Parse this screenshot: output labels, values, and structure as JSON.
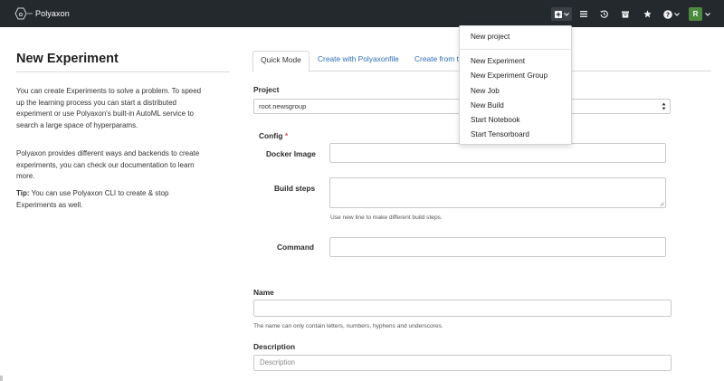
{
  "navbar": {
    "brand": "Polyaxon",
    "avatar_initial": "R",
    "background": "#24292e"
  },
  "sidebar": {
    "title": "New Experiment",
    "paragraph1": "You can create Experiments to solve a problem. To speed up the learning process you can start a distributed experiment or use Polyaxon's built-in AutoML service to search a large space of hyperparams.",
    "paragraph2": "Polyaxon provides different ways and backends to create experiments, you can check our documentation to learn more.",
    "tip_label": "Tip:",
    "tip_text": " You can use Polyaxon CLI to create & stop Experiments as well."
  },
  "tabs": [
    {
      "label": "Quick Mode",
      "active": true
    },
    {
      "label": "Create with Polyaxonfile",
      "active": false
    },
    {
      "label": "Create from t",
      "active": false
    }
  ],
  "form": {
    "project_label": "Project",
    "project_value": "root.newsgroup",
    "config_label": "Config",
    "required_mark": "*",
    "docker_image_label": "Docker Image",
    "build_steps_label": "Build steps",
    "build_steps_help": "Use new line to make different build steps.",
    "command_label": "Command",
    "name_label": "Name",
    "name_help": "The name can only contain letters, numbers, hyphens and underscores.",
    "description_label": "Description",
    "description_placeholder": "Description"
  },
  "dropdown": {
    "items": [
      "New project",
      "New Experiment",
      "New Experiment Group",
      "New Job",
      "New Build",
      "Start Notebook",
      "Start Tensorboard"
    ]
  },
  "colors": {
    "link": "#2e6fb6",
    "required": "#d9534f",
    "avatar": "#4c8b3f"
  },
  "icons": [
    "polyaxon-logo-icon",
    "plus-square-icon",
    "chevron-down-icon",
    "list-icon",
    "history-icon",
    "archive-icon",
    "star-icon",
    "help-circle-icon"
  ]
}
